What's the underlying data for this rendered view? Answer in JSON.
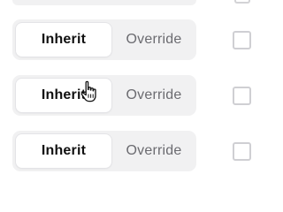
{
  "rows": [
    {
      "inherit_label": "Inherit",
      "override_label": "Override",
      "selected": "Inherit",
      "checked": false
    },
    {
      "inherit_label": "Inherit",
      "override_label": "Override",
      "selected": "Inherit",
      "checked": false
    },
    {
      "inherit_label": "Inherit",
      "override_label": "Override",
      "selected": "Inherit",
      "checked": false
    }
  ],
  "cursor": {
    "icon": "hand-pointer-icon"
  },
  "colors": {
    "segment_track": "#f1f1f2",
    "selected_segment": "#ffffff",
    "selected_text": "#111111",
    "unselected_text": "#6b6b70",
    "checkbox_border": "#cfcfd3"
  }
}
